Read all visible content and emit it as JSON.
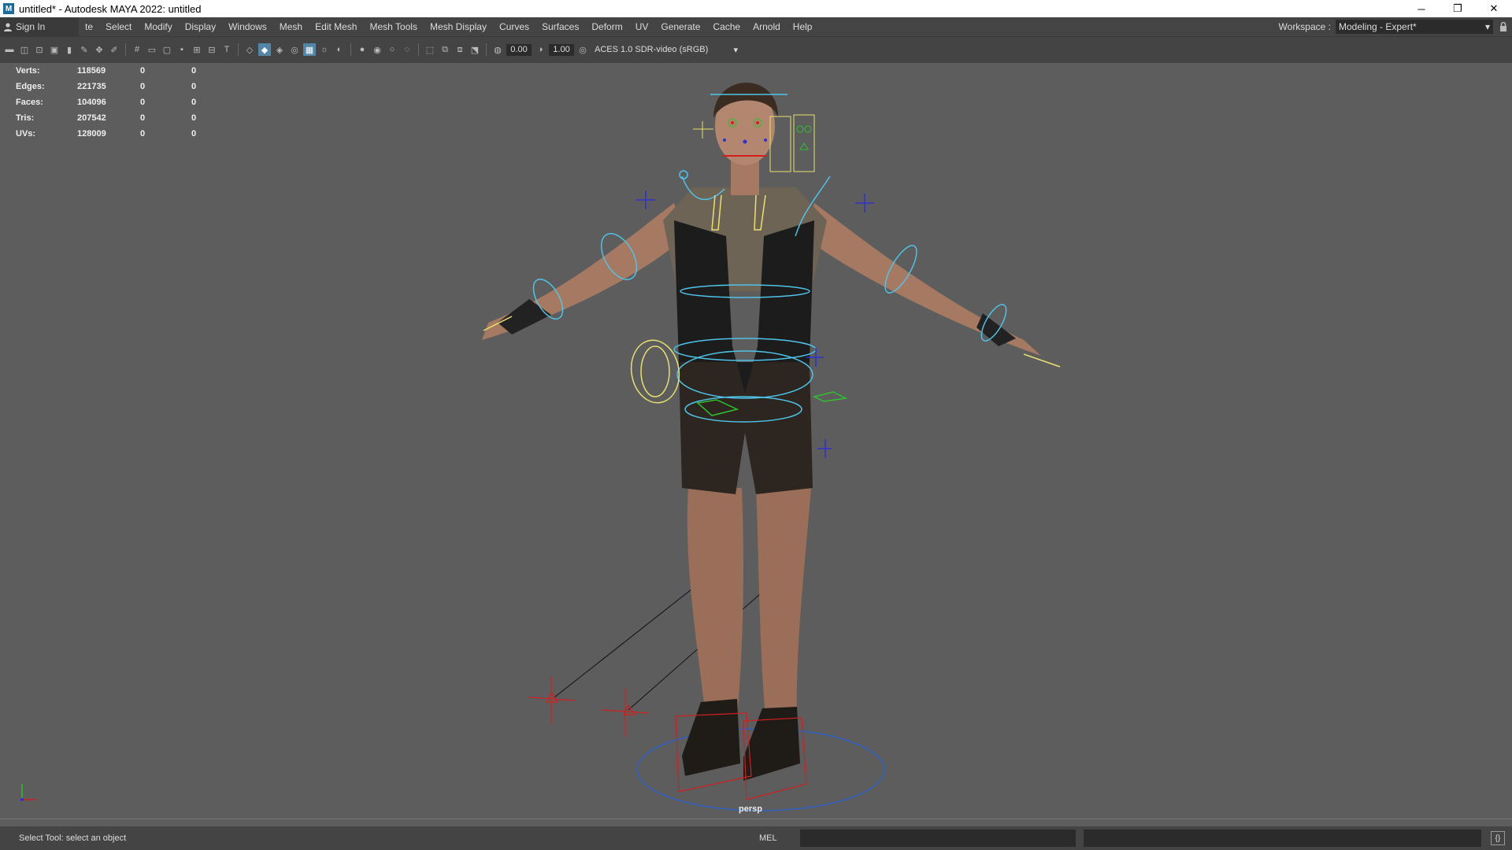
{
  "window": {
    "title": "untitled* - Autodesk MAYA 2022: untitled",
    "app_icon": "M",
    "minimize": "─",
    "restore": "❐",
    "close": "✕"
  },
  "menubar": {
    "signin_label": "Sign In",
    "items": [
      "te",
      "Select",
      "Modify",
      "Display",
      "Windows",
      "Mesh",
      "Edit Mesh",
      "Mesh Tools",
      "Mesh Display",
      "Curves",
      "Surfaces",
      "Deform",
      "UV",
      "Generate",
      "Cache",
      "Arnold",
      "Help"
    ],
    "workspace_label": "Workspace :",
    "workspace_value": "Modeling - Expert*"
  },
  "toolbar": {
    "near_value": "0.00",
    "far_value": "1.00",
    "color_space": "ACES 1.0 SDR-video (sRGB)"
  },
  "hud": {
    "rows": [
      {
        "label": "Verts:",
        "value": "118569",
        "c1": "0",
        "c2": "0"
      },
      {
        "label": "Edges:",
        "value": "221735",
        "c1": "0",
        "c2": "0"
      },
      {
        "label": "Faces:",
        "value": "104096",
        "c1": "0",
        "c2": "0"
      },
      {
        "label": "Tris:",
        "value": "207542",
        "c1": "0",
        "c2": "0"
      },
      {
        "label": "UVs:",
        "value": "128009",
        "c1": "0",
        "c2": "0"
      }
    ]
  },
  "viewport": {
    "camera_label": "persp"
  },
  "statusbar": {
    "help_text": "Select Tool: select an object",
    "mel_label": "MEL"
  },
  "colors": {
    "accent": "#5285a6",
    "rig_cyan": "#4fc3e8",
    "rig_yellow": "#e8e070",
    "rig_red": "#d02020",
    "rig_blue": "#3030d0"
  }
}
